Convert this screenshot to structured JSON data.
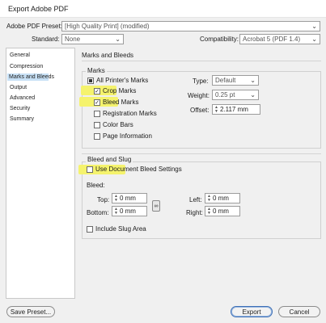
{
  "window": {
    "title": "Export Adobe PDF"
  },
  "top": {
    "preset_label": "Adobe PDF Preset:",
    "preset_value": "[High Quality Print] (modified)",
    "standard_label": "Standard:",
    "standard_value": "None",
    "compat_label": "Compatibility:",
    "compat_value": "Acrobat 5 (PDF 1.4)"
  },
  "sidebar": {
    "items": [
      {
        "label": "General"
      },
      {
        "label": "Compression"
      },
      {
        "label": "Marks and Bleeds",
        "selected": true
      },
      {
        "label": "Output"
      },
      {
        "label": "Advanced"
      },
      {
        "label": "Security"
      },
      {
        "label": "Summary"
      }
    ]
  },
  "main": {
    "section_title": "Marks and Bleeds",
    "marks": {
      "group_title": "Marks",
      "all_printers_marks": "All Printer's Marks",
      "crop_marks": "Crop Marks",
      "bleed_marks": "Bleed Marks",
      "registration_marks": "Registration Marks",
      "color_bars": "Color Bars",
      "page_information": "Page Information",
      "type_label": "Type:",
      "type_value": "Default",
      "weight_label": "Weight:",
      "weight_value": "0.25 pt",
      "offset_label": "Offset:",
      "offset_value": "2.117 mm"
    },
    "bleed": {
      "group_title": "Bleed and Slug",
      "use_document": "Use Document Bleed Settings",
      "bleed_label": "Bleed:",
      "top_label": "Top:",
      "top_value": "0 mm",
      "bottom_label": "Bottom:",
      "bottom_value": "0 mm",
      "left_label": "Left:",
      "left_value": "0 mm",
      "right_label": "Right:",
      "right_value": "0 mm",
      "include_slug": "Include Slug Area"
    }
  },
  "buttons": {
    "save_preset": "Save Preset...",
    "export": "Export",
    "cancel": "Cancel"
  },
  "icons": {
    "chevron": "chevron-down-icon",
    "check": "checkmark-icon",
    "spin": "spin-arrows-icon",
    "link": "chain-link-icon"
  },
  "colors": {
    "highlight": "#f7f43a",
    "selection": "#c8e1f6",
    "panel_bg": "#f0f0f0"
  },
  "checkbox_states": {
    "all_printers_marks": "partial",
    "crop_marks": true,
    "bleed_marks": true,
    "registration_marks": false,
    "color_bars": false,
    "page_information": false,
    "use_document": false,
    "include_slug": false
  }
}
